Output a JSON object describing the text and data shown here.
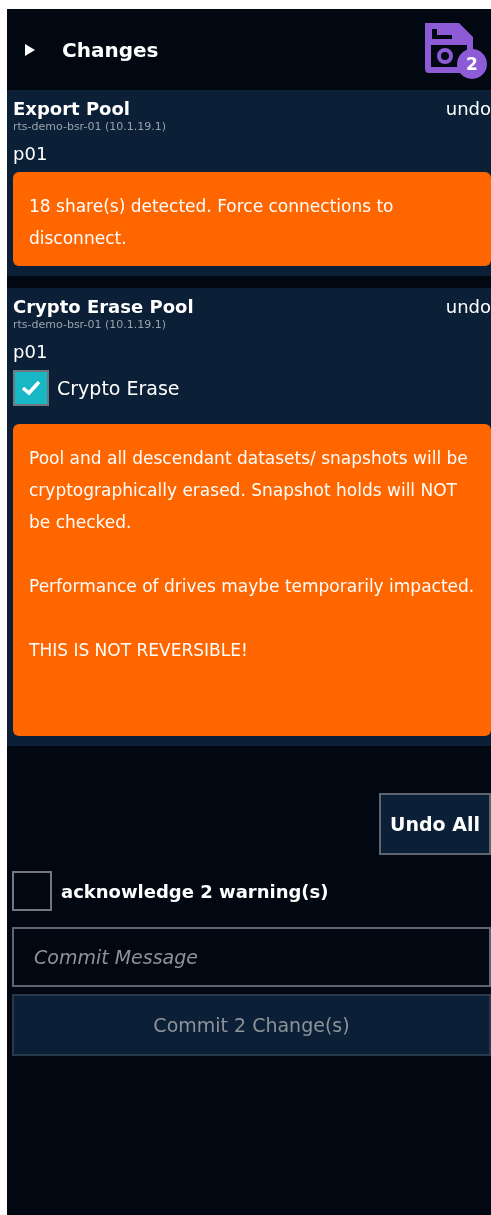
{
  "header": {
    "title": "Changes",
    "expanded": false,
    "badge": "2"
  },
  "changes": [
    {
      "title": "Export Pool",
      "host": "rts-demo-bsr-01 (10.1.19.1)",
      "undo": "undo",
      "target": "p01",
      "warning": [
        "18 share(s) detected. Force connections to disconnect."
      ]
    },
    {
      "title": "Crypto Erase Pool",
      "host": "rts-demo-bsr-01 (10.1.19.1)",
      "undo": "undo",
      "target": "p01",
      "option": {
        "label": "Crypto Erase",
        "checked": true
      },
      "warning": [
        "Pool and all descendant datasets/ snapshots will be cryptographically erased. Snapshot holds will NOT be checked.",
        "Performance of drives maybe temporarily impacted.",
        "THIS IS NOT REVERSIBLE!"
      ]
    }
  ],
  "undo_all": "Undo All",
  "acknowledge": {
    "label": "acknowledge 2 warning(s)",
    "checked": false
  },
  "commit_message": {
    "placeholder": "Commit Message"
  },
  "commit_button": {
    "label": "Commit 2 Change(s)",
    "disabled": true
  }
}
